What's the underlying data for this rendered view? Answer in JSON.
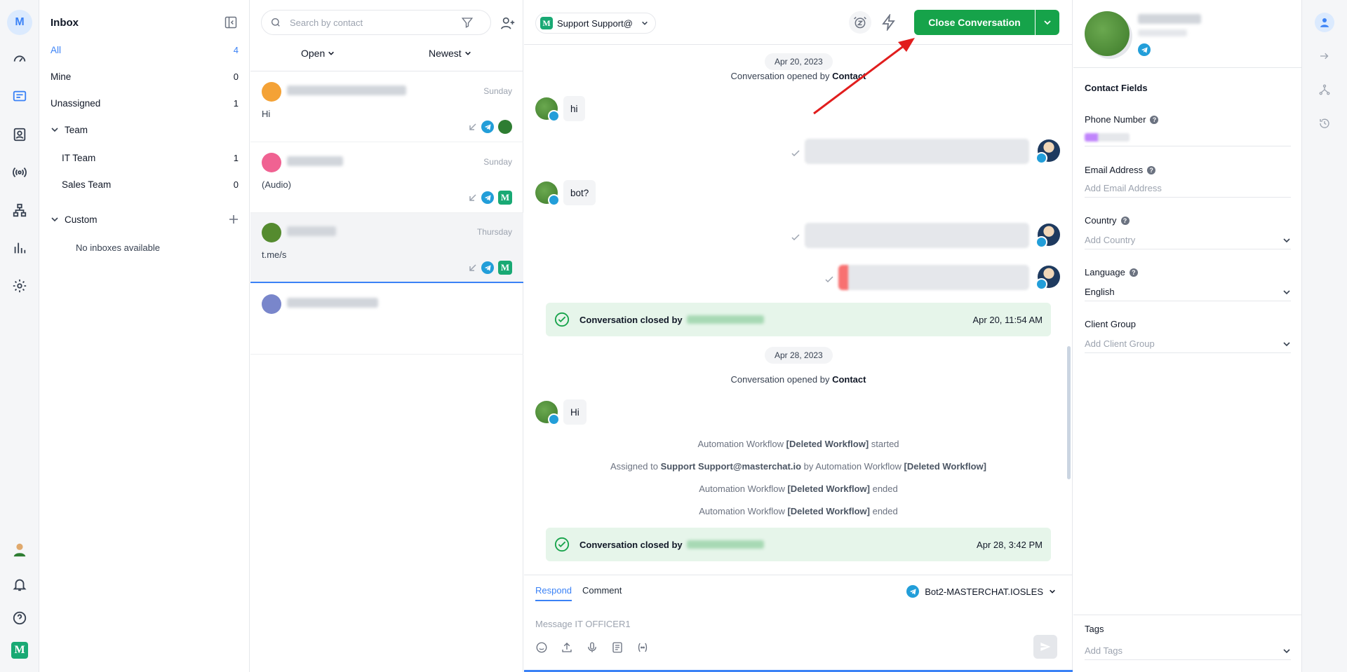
{
  "rail": {
    "avatar_initial": "M",
    "icons": [
      "dashboard-icon",
      "conversations-icon",
      "contacts-icon",
      "broadcast-icon",
      "workflows-icon",
      "reports-icon",
      "settings-icon",
      "user-avatar",
      "bell-icon",
      "help-icon",
      "masterchat-logo"
    ]
  },
  "inbox": {
    "title": "Inbox",
    "items": [
      {
        "label": "All",
        "count": "4"
      },
      {
        "label": "Mine",
        "count": "0"
      },
      {
        "label": "Unassigned",
        "count": "1"
      }
    ],
    "team": {
      "label": "Team",
      "items": [
        {
          "label": "IT Team",
          "count": "1"
        },
        {
          "label": "Sales Team",
          "count": "0"
        }
      ]
    },
    "custom": {
      "label": "Custom",
      "empty": "No inboxes available"
    }
  },
  "list": {
    "search_placeholder": "Search by contact",
    "status_filter": "Open",
    "sort": "Newest",
    "conversations": [
      {
        "day": "Sunday",
        "preview": "Hi"
      },
      {
        "day": "Sunday",
        "preview": "(Audio)"
      },
      {
        "day": "Thursday",
        "preview": "t.me/s"
      },
      {
        "day": "",
        "preview": ""
      }
    ]
  },
  "chat": {
    "agent": "Support Support@",
    "close_label": "Close Conversation",
    "messages": {
      "date1": "Apr 20, 2023",
      "opened1_prefix": "Conversation opened by",
      "opened1_who": "Contact",
      "in1": "hi",
      "in2": "bot?",
      "closed1_label": "Conversation closed by",
      "closed1_time": "Apr 20, 11:54 AM",
      "date2": "Apr 28, 2023",
      "opened2_prefix": "Conversation opened by",
      "opened2_who": "Contact",
      "in3": "Hi",
      "wf1_prefix": "Automation Workflow",
      "wf1_name": "[Deleted Workflow]",
      "wf1_suffix": "started",
      "assign_prefix": "Assigned to",
      "assign_who": "Support Support@masterchat.io",
      "assign_mid": "by Automation Workflow",
      "assign_wf": "[Deleted Workflow]",
      "wf2_prefix": "Automation Workflow",
      "wf2_name": "[Deleted Workflow]",
      "wf2_suffix": "ended",
      "wf3_prefix": "Automation Workflow",
      "wf3_name": "[Deleted Workflow]",
      "wf3_suffix": "ended",
      "closed2_label": "Conversation closed by",
      "closed2_time": "Apr 28, 3:42 PM"
    },
    "composer": {
      "tab_respond": "Respond",
      "tab_comment": "Comment",
      "channel": "Bot2-MASTERCHAT.IOSLES",
      "placeholder": "Message IT OFFICER1"
    }
  },
  "contact": {
    "fields_title": "Contact Fields",
    "phone_label": "Phone Number",
    "email_label": "Email Address",
    "email_placeholder": "Add Email Address",
    "country_label": "Country",
    "country_placeholder": "Add Country",
    "language_label": "Language",
    "language_value": "English",
    "client_group_label": "Client Group",
    "client_group_placeholder": "Add Client Group",
    "tags_label": "Tags",
    "tags_placeholder": "Add Tags"
  },
  "colors": {
    "accent": "#3b82f6",
    "primary_action": "#16a34a",
    "telegram": "#229ed9",
    "annotation_arrow": "#e11d1d"
  }
}
